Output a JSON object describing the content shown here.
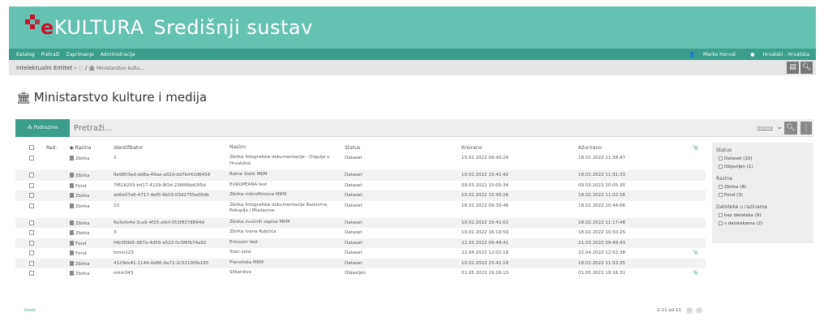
{
  "app": {
    "brand_e": "e",
    "brand_rest": "KULTURA",
    "subtitle": "Središnji sustav"
  },
  "nav": {
    "items": [
      "Katalog",
      "Pretraži",
      "Zaprimanje",
      "Administracija"
    ],
    "user": "Marko Horvat",
    "language": "Hrvatski - Hrvatska"
  },
  "breadcrumb": {
    "root": "Intelektualni Entitet",
    "current": "Ministarstvo kultu..."
  },
  "page": {
    "title": "Ministarstvo kulture i medija"
  },
  "toolbar": {
    "levels_button": "Podrazine",
    "search_placeholder": "Pretraži...",
    "sort_label": "Izmjena"
  },
  "table": {
    "headers": {
      "order": "Red.",
      "level": "Razina",
      "identifier": "Identifikator",
      "title": "Naslov",
      "status": "Status",
      "created": "Kreirano",
      "updated": "Ažurirano"
    },
    "rows": [
      {
        "level": "Zbirka",
        "id": "2",
        "title": "Zbirka fotografske dokumentacije - Orgulje u Hrvatskoj",
        "status": "Dataset",
        "created": "15.02.2022 09:40:24",
        "updated": "18.02.2022 11:38:47",
        "attach": false,
        "tall": true
      },
      {
        "level": "Zbirka",
        "id": "9e9803ed-dd8a-49ae-a02d-dd7b042d6458",
        "title": "Ratne štete MKM",
        "status": "Dataset",
        "created": "10.02.2022 15:41:42",
        "updated": "18.02.2022 11:31:33",
        "attach": false,
        "tall": false
      },
      {
        "level": "Fond",
        "id": "7f618203-b417-4229-8f2d-236f66b63f5d",
        "title": "EUROPEANA test",
        "status": "Dataset",
        "created": "09.03.2022 10:05:34",
        "updated": "09.03.2022 10:05:35",
        "attach": false,
        "tall": false
      },
      {
        "level": "Zbirka",
        "id": "ab6e07e6-4717-4ef0-9b19-03d2755e00db",
        "title": "Zbirka mikrofilmova MKM",
        "status": "Dataset",
        "created": "10.02.2022 15:40:26",
        "updated": "18.02.2022 11:02:16",
        "attach": false,
        "tall": false
      },
      {
        "level": "Zbirka",
        "id": "10",
        "title": "Zbirka fotografske dokumentacije Banovine, Pokuplja i Moslavine",
        "status": "Dataset",
        "created": "16.02.2022 09:30:46",
        "updated": "18.02.2022 10:44:06",
        "attach": false,
        "tall": true
      },
      {
        "level": "Zbirka",
        "id": "6e3efe4d-3ca9-4f23-a9cf-053f8378894d",
        "title": "Zbirka zvučnih zapisa MKM",
        "status": "Dataset",
        "created": "10.02.2022 15:41:02",
        "updated": "18.02.2022 11:17:48",
        "attach": false,
        "tall": false
      },
      {
        "level": "Zbirka",
        "id": "3",
        "title": "Zbirka Ivana Rubčića",
        "status": "Dataset",
        "created": "10.02.2022 16:19:59",
        "updated": "18.02.2022 10:50:25",
        "attach": false,
        "tall": false
      },
      {
        "level": "Fond",
        "id": "f4b369b5-987a-4d59-a522-0c0f6fb74a92",
        "title": "Ericsson test",
        "status": "Dataset",
        "created": "21.03.2022 09:49:41",
        "updated": "21.03.2022 09:49:43",
        "attach": false,
        "tall": false
      },
      {
        "level": "Fond",
        "id": "tomo123",
        "title": "Stari spisi",
        "status": "Dataset",
        "created": "22.04.2022 12:02:18",
        "updated": "22.04.2022 12:02:38",
        "attach": true,
        "tall": false
      },
      {
        "level": "Zbirka",
        "id": "4129dc41-1144-4d86-9a72-2c5210f0b165",
        "title": "Planoteka MKM",
        "status": "Dataset",
        "created": "10.02.2022 15:41:18",
        "updated": "18.02.2022 11:53:35",
        "attach": false,
        "tall": false
      },
      {
        "level": "Zbirka",
        "id": "mkm343",
        "title": "Slikarstvo",
        "status": "Objavljen",
        "created": "01.05.2022 19:16:10",
        "updated": "01.05.2022 19:16:31",
        "attach": true,
        "tall": false
      }
    ]
  },
  "footer": {
    "export": "Izvoz",
    "pager": "1-11 od 11"
  },
  "facets": {
    "status_title": "Status",
    "status_items": [
      "Dataset (10)",
      "Objavljen (1)"
    ],
    "level_title": "Razine",
    "level_items": [
      "Zbirka (8)",
      "Fond (3)"
    ],
    "files_title": "Datoteke u razinama",
    "files_items": [
      "bez datoteka (9)",
      "s datotekama (2)"
    ]
  },
  "colors": {
    "banner": "#66c2b0",
    "accent": "#3a9e8a",
    "brand_red": "#c8102e"
  }
}
